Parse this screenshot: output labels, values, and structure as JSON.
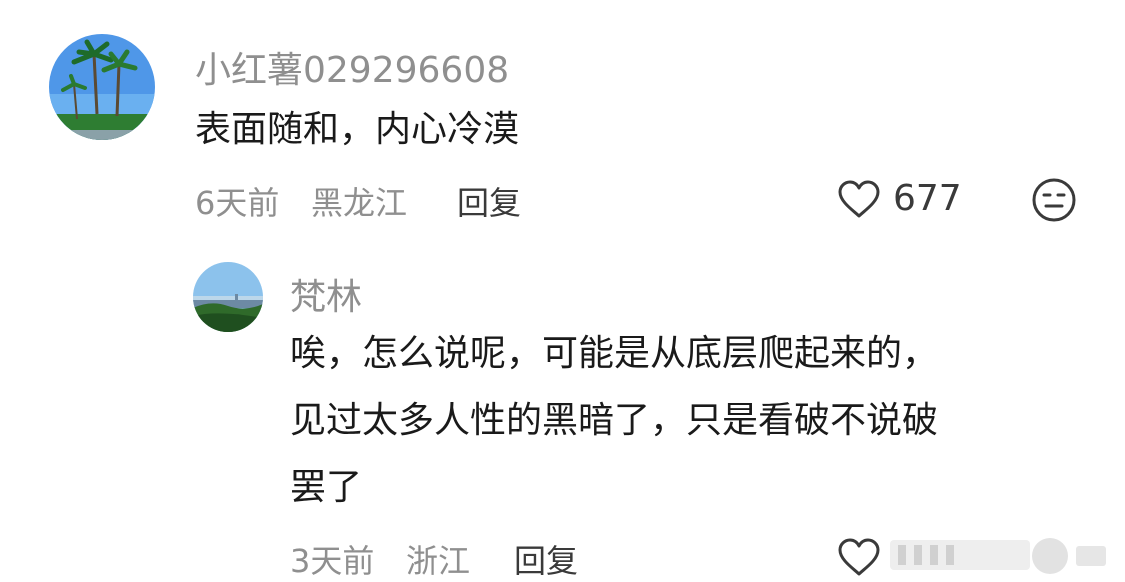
{
  "comments": [
    {
      "username": "小红薯029296608",
      "text": "表面随和，内心冷漠",
      "time": "6天前",
      "location": "黑龙江",
      "reply_label": "回复",
      "likes": "677",
      "avatar_icon": "palm-tree-avatar",
      "like_icon": "heart-outline-icon",
      "emoji_icon": "neutral-face-icon"
    }
  ],
  "replies": [
    {
      "username": "梵林",
      "text_lines": [
        "唉，怎么说呢，可能是从底层爬起来的，",
        "见过太多人性的黑暗了，只是看破不说破",
        "罢了"
      ],
      "time": "3天前",
      "location": "浙江",
      "reply_label": "回复",
      "avatar_icon": "lake-landscape-avatar",
      "like_icon": "heart-outline-icon"
    }
  ],
  "colors": {
    "text": "#1a1a1a",
    "muted": "#8f8f8f",
    "icon": "#3a3a3a"
  }
}
